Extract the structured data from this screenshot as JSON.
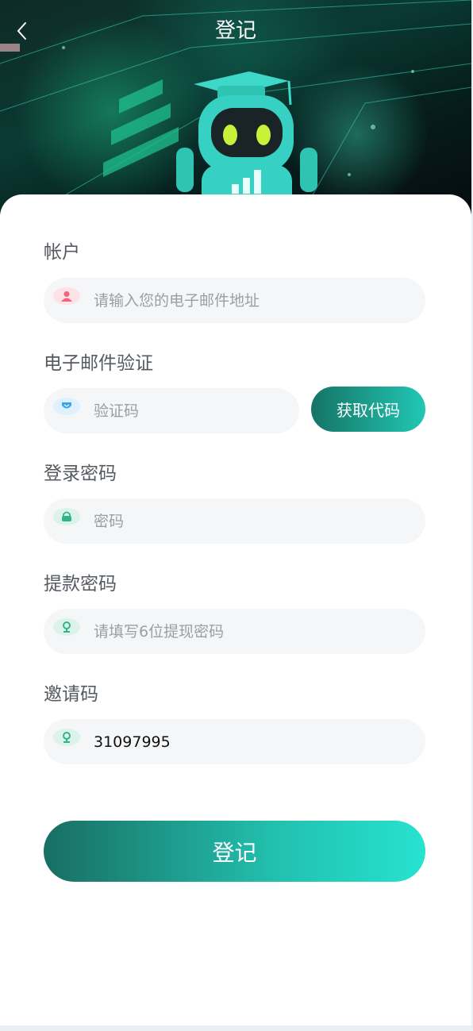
{
  "header": {
    "title": "登记"
  },
  "form": {
    "account": {
      "label": "帐户",
      "placeholder": "请输入您的电子邮件地址",
      "value": "",
      "icon": "user-icon",
      "icon_color": "#f0647c"
    },
    "email_verify": {
      "label": "电子邮件验证",
      "placeholder": "验证码",
      "value": "",
      "icon": "shield-icon",
      "icon_color": "#3aa6e8",
      "send_button_label": "获取代码"
    },
    "login_password": {
      "label": "登录密码",
      "placeholder": "密码",
      "value": "",
      "icon": "lock-icon",
      "icon_color": "#34b38a"
    },
    "withdraw_password": {
      "label": "提款密码",
      "placeholder": "请填写6位提现密码",
      "value": "",
      "icon": "key-icon",
      "icon_color": "#34b38a"
    },
    "invite_code": {
      "label": "邀请码",
      "placeholder": "",
      "value": "31097995",
      "icon": "key-icon",
      "icon_color": "#34b38a"
    },
    "submit_label": "登记"
  },
  "colors": {
    "accent_start": "#157466",
    "accent_end": "#26e3d0"
  }
}
